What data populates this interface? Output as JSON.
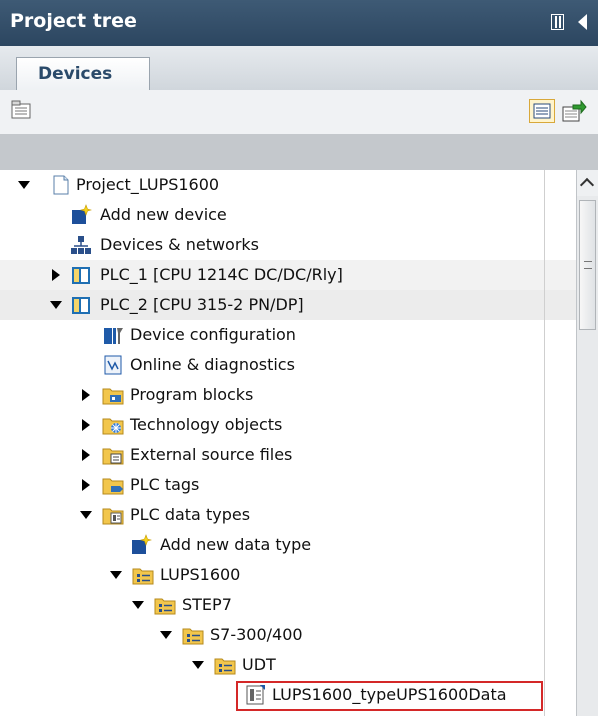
{
  "panel": {
    "title": "Project tree",
    "tab": "Devices"
  },
  "tree": {
    "items": [
      {
        "label": "Project_LUPS1600",
        "icon": "project-icon"
      },
      {
        "label": "Add new device",
        "icon": "add-device-icon"
      },
      {
        "label": "Devices & networks",
        "icon": "network-icon"
      },
      {
        "label": "PLC_1 [CPU 1214C DC/DC/Rly]",
        "icon": "plc-icon"
      },
      {
        "label": "PLC_2 [CPU 315-2 PN/DP]",
        "icon": "plc-icon"
      },
      {
        "label": "Device configuration",
        "icon": "device-config-icon"
      },
      {
        "label": "Online & diagnostics",
        "icon": "diagnostics-icon"
      },
      {
        "label": "Program blocks",
        "icon": "folder-blocks-icon"
      },
      {
        "label": "Technology objects",
        "icon": "folder-technology-icon"
      },
      {
        "label": "External source files",
        "icon": "folder-source-icon"
      },
      {
        "label": "PLC tags",
        "icon": "folder-tags-icon"
      },
      {
        "label": "PLC data types",
        "icon": "folder-datatypes-icon"
      },
      {
        "label": "Add new data type",
        "icon": "add-datatype-icon"
      },
      {
        "label": "LUPS1600",
        "icon": "folder-group-icon"
      },
      {
        "label": "STEP7",
        "icon": "folder-group-icon"
      },
      {
        "label": "S7-300/400",
        "icon": "folder-group-icon"
      },
      {
        "label": "UDT",
        "icon": "folder-group-icon"
      },
      {
        "label": "LUPS1600_typeUPS1600Data",
        "icon": "udt-icon"
      }
    ]
  },
  "colors": {
    "title_bar": "#2c4660",
    "highlight": "#d42828"
  }
}
